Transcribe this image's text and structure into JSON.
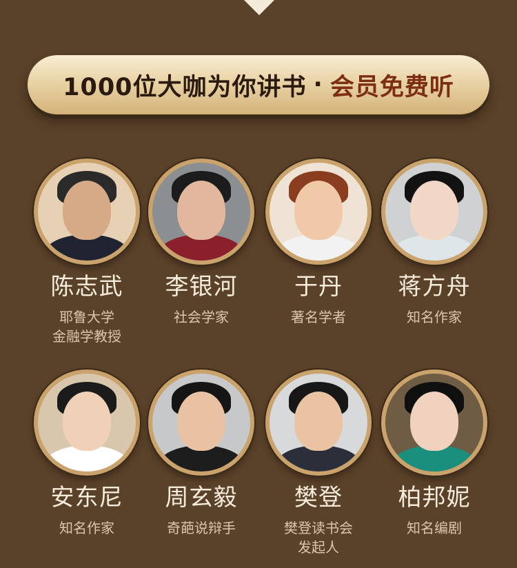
{
  "banner": {
    "part1": "1000位大咖为你讲书",
    "dot": "·",
    "part2": "会员免费听"
  },
  "people": [
    {
      "name": "陈志武",
      "title_line1": "耶鲁大学",
      "title_line2": "金融学教授",
      "bg": "#e7d1b5",
      "skin": "#d7aa87",
      "hair": "#2a2a2a",
      "body": "#1f2430"
    },
    {
      "name": "李银河",
      "title_line1": "社会学家",
      "title_line2": "",
      "bg": "#8c8f92",
      "skin": "#e2b79e",
      "hair": "#1c1c1c",
      "body": "#8b1f2b"
    },
    {
      "name": "于丹",
      "title_line1": "著名学者",
      "title_line2": "",
      "bg": "#efe3d6",
      "skin": "#f0c9a8",
      "hair": "#8a3e1f",
      "body": "#f2f2f2"
    },
    {
      "name": "蒋方舟",
      "title_line1": "知名作家",
      "title_line2": "",
      "bg": "#cfd1d3",
      "skin": "#f2d7c6",
      "hair": "#121212",
      "body": "#dfe6ea"
    },
    {
      "name": "安东尼",
      "title_line1": "知名作家",
      "title_line2": "",
      "bg": "#d9c7ad",
      "skin": "#f0d0b7",
      "hair": "#1b1b1b",
      "body": "#ffffff"
    },
    {
      "name": "周玄毅",
      "title_line1": "奇葩说辩手",
      "title_line2": "",
      "bg": "#c7c8c9",
      "skin": "#e8c2a3",
      "hair": "#151515",
      "body": "#1d1d1d"
    },
    {
      "name": "樊登",
      "title_line1": "樊登读书会",
      "title_line2": "发起人",
      "bg": "#d7d9db",
      "skin": "#e9c3a2",
      "hair": "#171717",
      "body": "#2a2f3a"
    },
    {
      "name": "柏邦妮",
      "title_line1": "知名编剧",
      "title_line2": "",
      "bg": "#6f5c44",
      "skin": "#f1d2bf",
      "hair": "#0f0f0f",
      "body": "#1a8f7d"
    }
  ]
}
